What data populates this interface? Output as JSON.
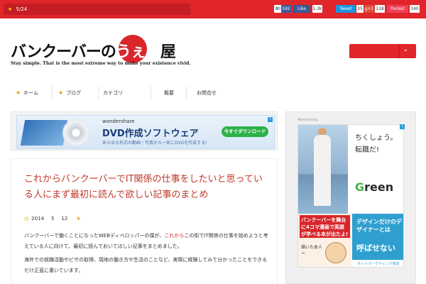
{
  "topbar": {
    "date_text": "5/24",
    "share": {
      "hatena_label": "B!",
      "hatena_count": "592",
      "facebook_label": "Like",
      "facebook_count": "1.3k",
      "twitter_label": "Tweet",
      "twitter_count": "35",
      "gplus_label": "g+1",
      "gplus_count": "118",
      "pocket_label": "Pocket",
      "pocket_count": "140"
    }
  },
  "header": {
    "logo_main": "バンクーバーの",
    "logo_accent": "うぇぶ",
    "logo_end": "屋",
    "tagline": "Stay simple. That is the most extreme way to make your existence vivid."
  },
  "nav": {
    "items": [
      "ホーム",
      "ブログ",
      "カテゴリ",
      "概要",
      "お問合せ"
    ]
  },
  "ad_top": {
    "brand": "wondershare",
    "title": "DVD作成ソフトウェア",
    "subtitle": "あらゆる形式の動画・写真から一気にDVDを作成する!",
    "button": "今すぐダウンロード"
  },
  "article": {
    "title": "これからバンクーバーでIT関係の仕事をしたいと思っている人にまず最初に読んで欲しい記事のまとめ",
    "date_year": "2014",
    "date_month": "5",
    "date_day": "12",
    "p1_before": "バンクーバーで働くことになったWEBディベロッパーの僕が、",
    "p1_highlight": "これから",
    "p1_after": "この街でIT関係の仕事を始めようと考えている人に向けて、最初に読んでおいてほしい記事をまとめました。",
    "p2": "海外での就職活動やビザの取得、現地の働き方や生活のことなど、実際に経験してみて分かったことをできるだけ正直に書いています。"
  },
  "sidebar": {
    "adv_label": "Advertising",
    "copy": "ちくしょう。転職だ!",
    "green_g": "G",
    "green_rest": "reen",
    "bl_top": "バンクーバーを舞台に4コマ漫画で英語が学べる本が出たよ!",
    "bl_text": "描いた本人→",
    "br_t1": "デザインだけのデザイナーとは",
    "br_t2": "呼ばせない",
    "br_foot": "ネットマーケティング検定"
  },
  "colors": {
    "brand_red": "#e0252b",
    "title_red": "#c0392b",
    "star_yellow": "#e8a000"
  }
}
